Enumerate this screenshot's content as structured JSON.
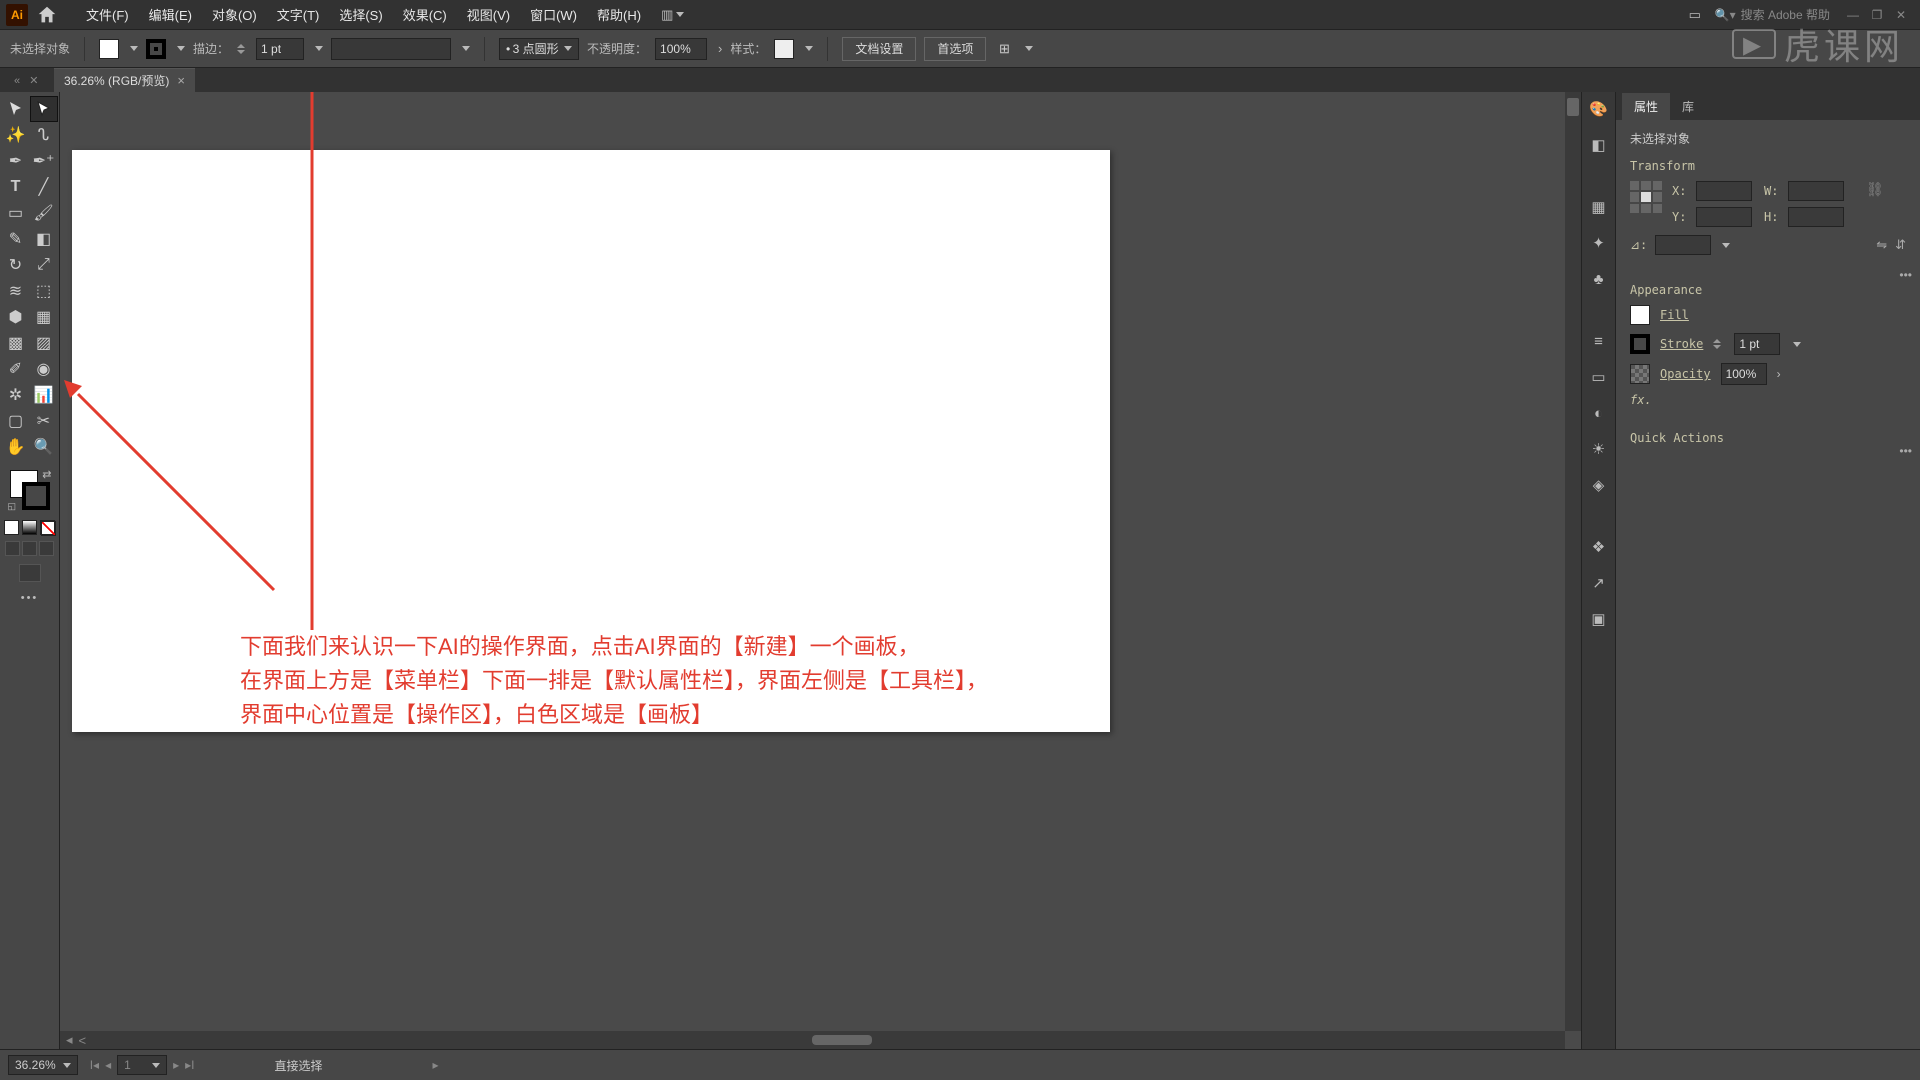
{
  "menubar": {
    "items": [
      "文件(F)",
      "编辑(E)",
      "对象(O)",
      "文字(T)",
      "选择(S)",
      "效果(C)",
      "视图(V)",
      "窗口(W)",
      "帮助(H)"
    ],
    "search_placeholder": "搜索 Adobe 帮助"
  },
  "controlbar": {
    "no_selection": "未选择对象",
    "stroke_label": "描边：",
    "stroke_value": "1 pt",
    "brush_value": "3 点圆形",
    "opacity_label": "不透明度：",
    "opacity_value": "100%",
    "style_label": "样式：",
    "doc_setup": "文档设置",
    "preferences": "首选项"
  },
  "document_tab": {
    "title": "36.26% (RGB/预览)"
  },
  "canvas_text": {
    "line1": "下面我们来认识一下AI的操作界面，点击AI界面的【新建】一个画板，",
    "line2": "在界面上方是【菜单栏】下面一排是【默认属性栏】，界面左侧是【工具栏】，",
    "line3": "界面中心位置是【操作区】，白色区域是【画板】"
  },
  "properties": {
    "tab_properties": "属性",
    "tab_libraries": "库",
    "no_selection": "未选择对象",
    "transform_title": "Transform",
    "x_label": "X:",
    "y_label": "Y:",
    "w_label": "W:",
    "h_label": "H:",
    "angle_label": "⊿:",
    "appearance_title": "Appearance",
    "fill_label": "Fill",
    "stroke_label": "Stroke",
    "stroke_value": "1 pt",
    "opacity_label": "Opacity",
    "opacity_value": "100%",
    "fx_label": "fx.",
    "quick_actions": "Quick Actions"
  },
  "statusbar": {
    "zoom": "36.26%",
    "artboard_num": "1",
    "tool_name": "直接选择"
  },
  "watermark": "虎课网"
}
